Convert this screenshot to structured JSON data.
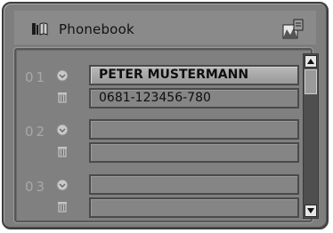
{
  "window": {
    "title": "Phonebook",
    "title_icon": "phonebook-icon",
    "corner_icon": "home-menu-icon"
  },
  "entries": [
    {
      "number": "01",
      "line1": "PETER MUSTERMANN",
      "line2": "0681-123456-780"
    },
    {
      "number": "02",
      "line1": "",
      "line2": ""
    },
    {
      "number": "03",
      "line1": "",
      "line2": ""
    }
  ],
  "icons": {
    "select": "select-circle-icon",
    "delete": "trash-icon",
    "scroll_up": "arrow-up-icon",
    "scroll_down": "arrow-down-icon"
  },
  "colors": {
    "panel": "#7e7e7e",
    "field_highlight": "#b3b3b3",
    "number_text": "#a8a8a8"
  }
}
